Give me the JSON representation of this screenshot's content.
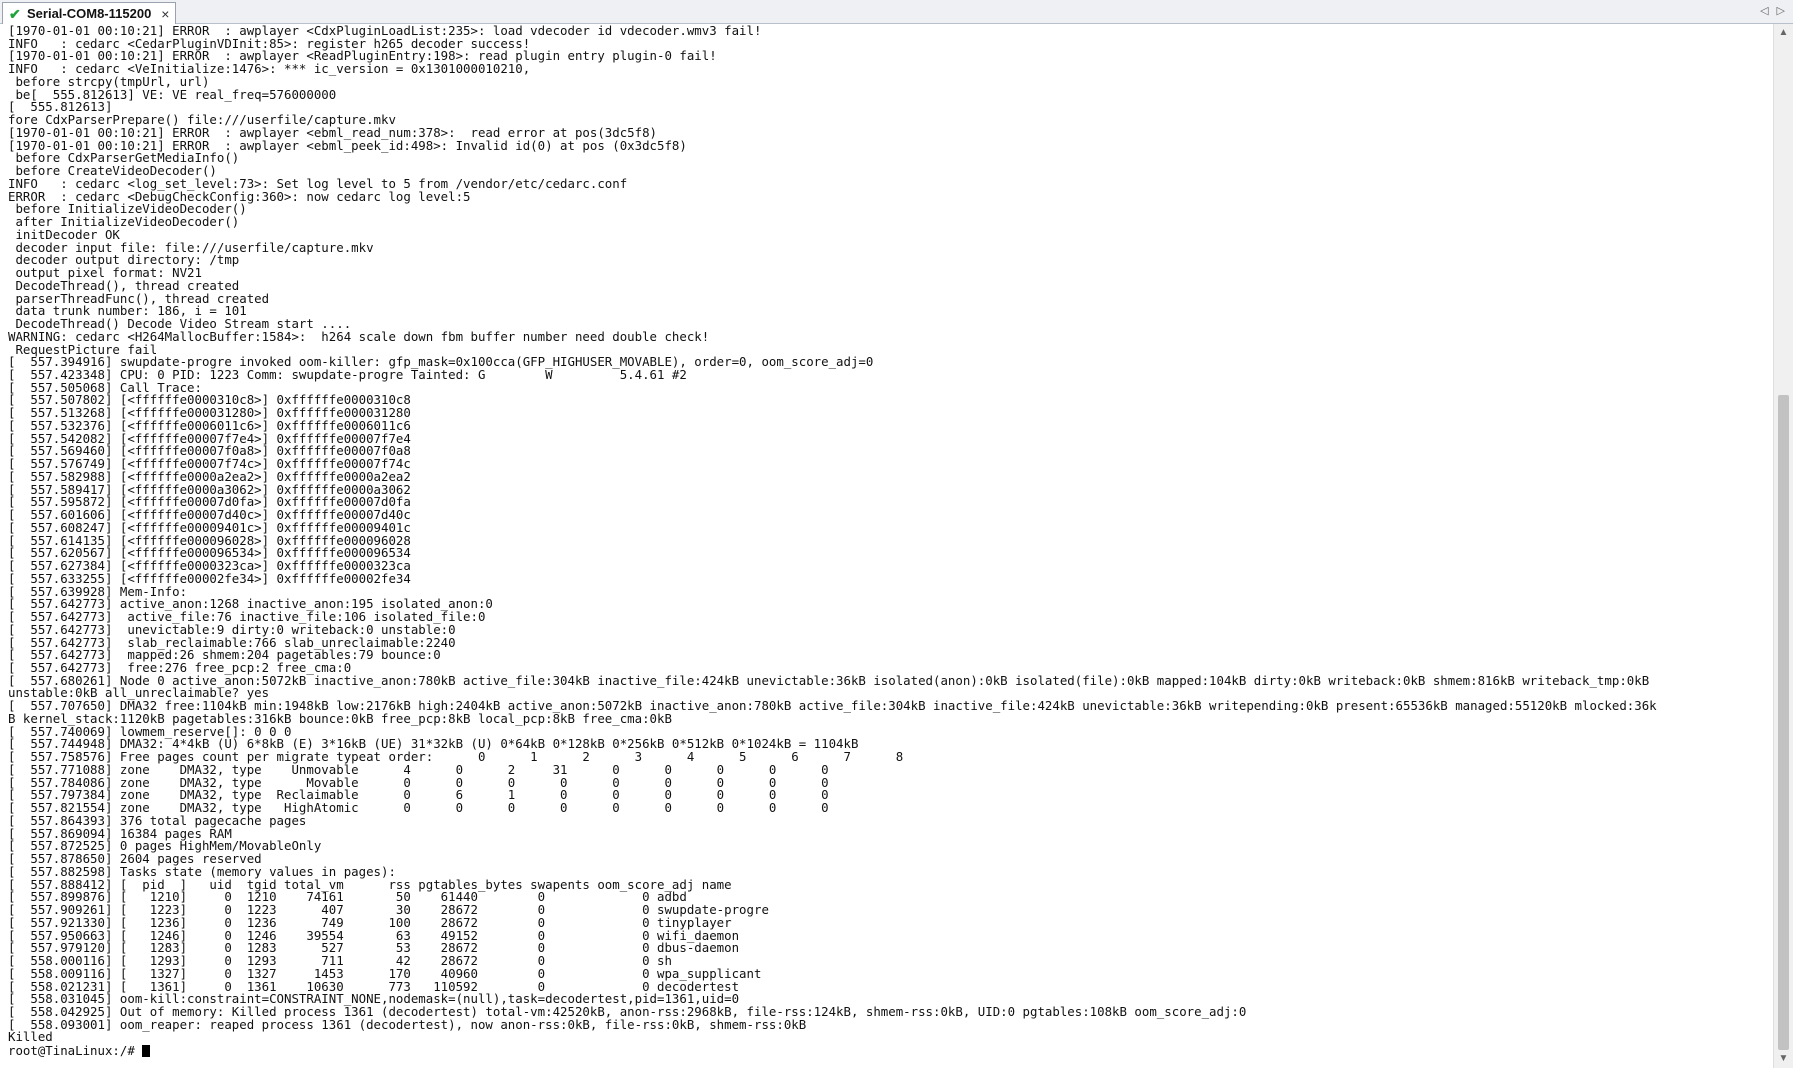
{
  "tab": {
    "label": "Serial-COM8-115200",
    "close_glyph": "×",
    "status_icon": "check-icon",
    "status_color": "#1fa33a"
  },
  "nav": {
    "left": "◁",
    "right": "▷"
  },
  "scrollbar": {
    "up": "▲",
    "down": "▼",
    "thumb_position": 0.35,
    "thumb_size": 0.65
  },
  "terminal": {
    "lines": [
      "[1970-01-01 00:10:21] ERROR  : awplayer <CdxPluginLoadList:235>: load vdecoder id vdecoder.wmv3 fail!",
      "INFO   : cedarc <CedarPluginVDInit:85>: register h265 decoder success!",
      "[1970-01-01 00:10:21] ERROR  : awplayer <ReadPluginEntry:198>: read plugin entry plugin-0 fail!",
      "INFO   : cedarc <VeInitialize:1476>: *** ic_version = 0x1301000010210,",
      " before strcpy(tmpUrl, url)",
      " be[  555.812613] VE: VE real_freq=576000000",
      "[  555.812613]",
      "fore CdxParserPrepare() file:///userfile/capture.mkv",
      "[1970-01-01 00:10:21] ERROR  : awplayer <ebml_read_num:378>:  read error at pos(3dc5f8)",
      "[1970-01-01 00:10:21] ERROR  : awplayer <ebml_peek_id:498>: Invalid id(0) at pos (0x3dc5f8)",
      " before CdxParserGetMediaInfo()",
      " before CreateVideoDecoder()",
      "INFO   : cedarc <log_set_level:73>: Set log level to 5 from /vendor/etc/cedarc.conf",
      "ERROR  : cedarc <DebugCheckConfig:360>: now cedarc log level:5",
      " before InitializeVideoDecoder()",
      " after InitializeVideoDecoder()",
      " initDecoder OK",
      " decoder input file: file:///userfile/capture.mkv",
      " decoder output directory: /tmp",
      " output pixel format: NV21",
      " DecodeThread(), thread created",
      " parserThreadFunc(), thread created",
      " data trunk number: 186, i = 101",
      " DecodeThread() Decode Video Stream start ....",
      "WARNING: cedarc <H264MallocBuffer:1584>:  h264 scale down fbm buffer number need double check!",
      " RequestPicture fail",
      "[  557.394916] swupdate-progre invoked oom-killer: gfp_mask=0x100cca(GFP_HIGHUSER_MOVABLE), order=0, oom_score_adj=0",
      "[  557.423348] CPU: 0 PID: 1223 Comm: swupdate-progre Tainted: G        W         5.4.61 #2",
      "[  557.505068] Call Trace:",
      "[  557.507802] [<ffffffe0000310c8>] 0xffffffe0000310c8",
      "[  557.513268] [<ffffffe000031280>] 0xffffffe000031280",
      "[  557.532376] [<ffffffe0006011c6>] 0xffffffe0006011c6",
      "[  557.542082] [<ffffffe00007f7e4>] 0xffffffe00007f7e4",
      "[  557.569460] [<ffffffe00007f0a8>] 0xffffffe00007f0a8",
      "[  557.576749] [<ffffffe00007f74c>] 0xffffffe00007f74c",
      "[  557.582988] [<ffffffe0000a2ea2>] 0xffffffe0000a2ea2",
      "[  557.589417] [<ffffffe0000a3062>] 0xffffffe0000a3062",
      "[  557.595872] [<ffffffe00007d0fa>] 0xffffffe00007d0fa",
      "[  557.601606] [<ffffffe00007d40c>] 0xffffffe00007d40c",
      "[  557.608247] [<ffffffe00009401c>] 0xffffffe00009401c",
      "[  557.614135] [<ffffffe000096028>] 0xffffffe000096028",
      "[  557.620567] [<ffffffe000096534>] 0xffffffe000096534",
      "[  557.627384] [<ffffffe0000323ca>] 0xffffffe0000323ca",
      "[  557.633255] [<ffffffe00002fe34>] 0xffffffe00002fe34",
      "[  557.639928] Mem-Info:",
      "[  557.642773] active_anon:1268 inactive_anon:195 isolated_anon:0",
      "[  557.642773]  active_file:76 inactive_file:106 isolated_file:0",
      "[  557.642773]  unevictable:9 dirty:0 writeback:0 unstable:0",
      "[  557.642773]  slab_reclaimable:766 slab_unreclaimable:2240",
      "[  557.642773]  mapped:26 shmem:204 pagetables:79 bounce:0",
      "[  557.642773]  free:276 free_pcp:2 free_cma:0",
      "[  557.680261] Node 0 active_anon:5072kB inactive_anon:780kB active_file:304kB inactive_file:424kB unevictable:36kB isolated(anon):0kB isolated(file):0kB mapped:104kB dirty:0kB writeback:0kB shmem:816kB writeback_tmp:0kB",
      "unstable:0kB all_unreclaimable? yes",
      "[  557.707650] DMA32 free:1104kB min:1948kB low:2176kB high:2404kB active_anon:5072kB inactive_anon:780kB active_file:304kB inactive_file:424kB unevictable:36kB writepending:0kB present:65536kB managed:55120kB mlocked:36k",
      "B kernel_stack:1120kB pagetables:316kB bounce:0kB free_pcp:8kB local_pcp:8kB free_cma:0kB",
      "[  557.740069] lowmem_reserve[]: 0 0 0",
      "[  557.744948] DMA32: 4*4kB (U) 6*8kB (E) 3*16kB (UE) 31*32kB (U) 0*64kB 0*128kB 0*256kB 0*512kB 0*1024kB = 1104kB",
      "[  557.758576] Free pages count per migrate typeat order:      0      1      2      3      4      5      6      7      8",
      "[  557.771088] zone    DMA32, type    Unmovable      4      0      2     31      0      0      0      0      0",
      "[  557.784086] zone    DMA32, type      Movable      0      0      0      0      0      0      0      0      0",
      "[  557.797384] zone    DMA32, type  Reclaimable      0      6      1      0      0      0      0      0      0",
      "[  557.821554] zone    DMA32, type   HighAtomic      0      0      0      0      0      0      0      0      0",
      "[  557.864393] 376 total pagecache pages",
      "[  557.869094] 16384 pages RAM",
      "[  557.872525] 0 pages HighMem/MovableOnly",
      "[  557.878650] 2604 pages reserved",
      "[  557.882598] Tasks state (memory values in pages):",
      "[  557.888412] [  pid  ]   uid  tgid total_vm      rss pgtables_bytes swapents oom_score_adj name",
      "[  557.899876] [   1210]     0  1210    74161       50    61440        0             0 adbd",
      "[  557.909261] [   1223]     0  1223      407       30    28672        0             0 swupdate-progre",
      "[  557.921330] [   1236]     0  1236      749      100    28672        0             0 tinyplayer",
      "[  557.950663] [   1246]     0  1246    39554       63    49152        0             0 wifi_daemon",
      "[  557.979120] [   1283]     0  1283      527       53    28672        0             0 dbus-daemon",
      "[  558.000116] [   1293]     0  1293      711       42    28672        0             0 sh",
      "[  558.009116] [   1327]     0  1327     1453      170    40960        0             0 wpa_supplicant",
      "[  558.021231] [   1361]     0  1361    10630      773   110592        0             0 decodertest",
      "[  558.031045] oom-kill:constraint=CONSTRAINT_NONE,nodemask=(null),task=decodertest,pid=1361,uid=0",
      "[  558.042925] Out of memory: Killed process 1361 (decodertest) total-vm:42520kB, anon-rss:2968kB, file-rss:124kB, shmem-rss:0kB, UID:0 pgtables:108kB oom_score_adj:0",
      "[  558.093001] oom_reaper: reaped process 1361 (decodertest), now anon-rss:0kB, file-rss:0kB, shmem-rss:0kB",
      "Killed"
    ],
    "prompt": "root@TinaLinux:/# "
  }
}
